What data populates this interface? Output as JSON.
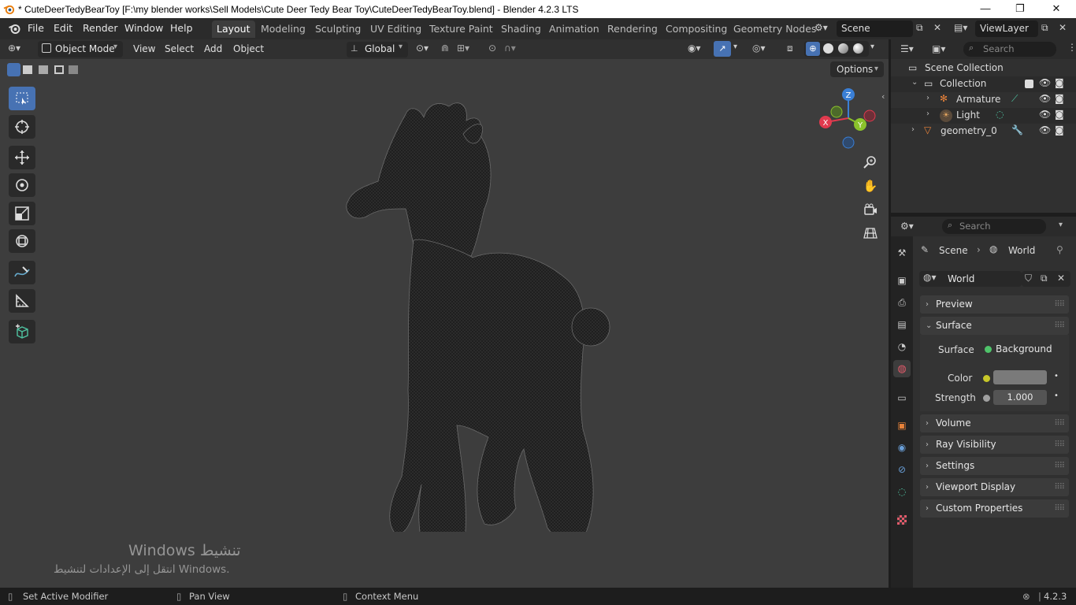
{
  "window": {
    "title": "* CuteDeerTedyBearToy [F:\\my blender works\\Sell Models\\Cute Deer Tedy Bear Toy\\CuteDeerTedyBearToy.blend] - Blender 4.2.3 LTS",
    "minimize": "—",
    "maximize": "❐",
    "close": "✕"
  },
  "menubar": {
    "items": [
      "File",
      "Edit",
      "Render",
      "Window",
      "Help"
    ]
  },
  "workspaces": {
    "tabs": [
      "Layout",
      "Modeling",
      "Sculpting",
      "UV Editing",
      "Texture Paint",
      "Shading",
      "Animation",
      "Rendering",
      "Compositing",
      "Geometry Nodes"
    ],
    "active": "Layout"
  },
  "scene_selector": {
    "value": "Scene"
  },
  "viewlayer_selector": {
    "value": "ViewLayer"
  },
  "viewport_header": {
    "mode": "Object Mode",
    "menus": [
      "View",
      "Select",
      "Add",
      "Object"
    ],
    "transform_orientation": "Global",
    "options_label": "Options"
  },
  "viewport": {
    "watermark_title": "Windows تنشيط",
    "watermark_sub": "انتقل إلى الإعدادات لتنشيط Windows.",
    "gizmo_axes": {
      "x": "X",
      "y": "Y",
      "z": "Z"
    },
    "colors": {
      "x": "#e03a4e",
      "y": "#8bc22b",
      "z": "#3a7fd6"
    }
  },
  "outliner": {
    "search_placeholder": "Search",
    "rows": [
      {
        "label": "Scene Collection"
      },
      {
        "label": "Collection"
      },
      {
        "label": "Armature"
      },
      {
        "label": "Light"
      },
      {
        "label": "geometry_0"
      }
    ]
  },
  "properties": {
    "search_placeholder": "Search",
    "breadcrumb": {
      "scene": "Scene",
      "world": "World"
    },
    "datablock": "World",
    "panels": {
      "preview": "Preview",
      "surface": "Surface",
      "volume": "Volume",
      "ray_visibility": "Ray Visibility",
      "settings": "Settings",
      "viewport_display": "Viewport Display",
      "custom_properties": "Custom Properties"
    },
    "surface_label": "Surface",
    "surface_value": "Background",
    "color_label": "Color",
    "color_value": "#7a7a7a",
    "strength_label": "Strength",
    "strength_value": "1.000"
  },
  "statusbar": {
    "left": "Set Active Modifier",
    "middle": "Pan View",
    "right": "Context Menu",
    "version": "4.2.3"
  }
}
